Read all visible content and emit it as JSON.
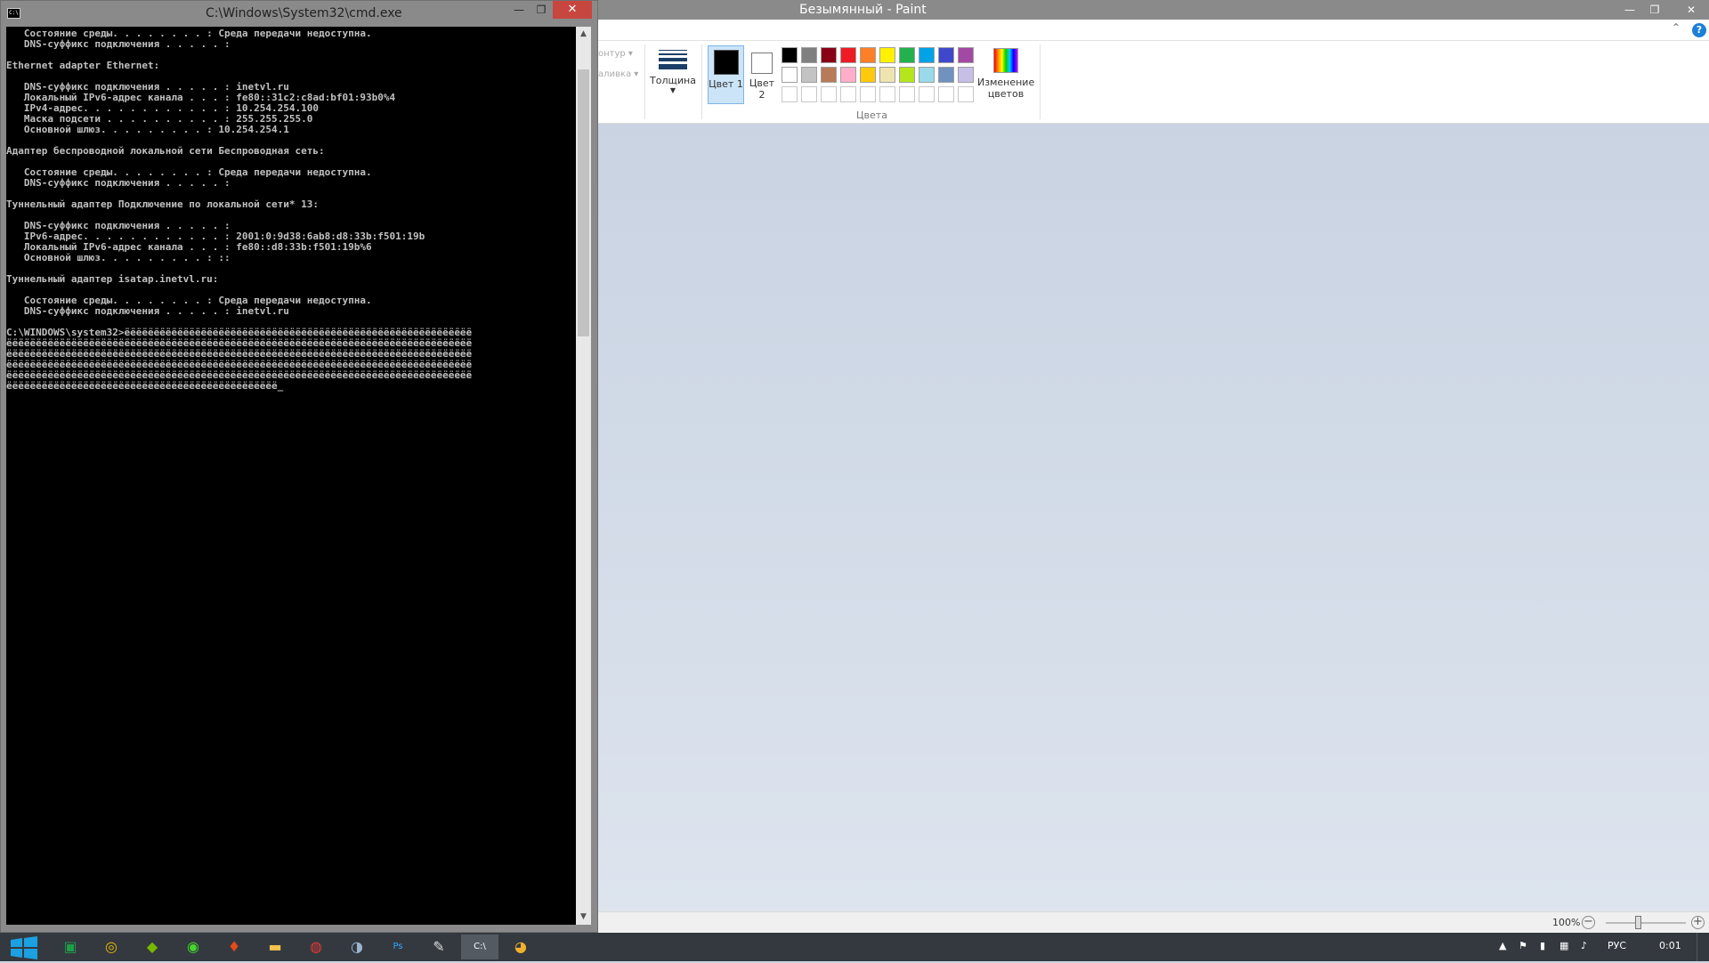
{
  "paint": {
    "title": "Безымянный - Paint",
    "ribbon": {
      "contour_label": "онтур ▾",
      "fill_label": "аливка ▾",
      "thickness_label": "Толщина",
      "color1_label": "Цвет 1",
      "color2_label": "Цвет 2",
      "edit_colors_label": "Изменение цветов",
      "colors_group_label": "Цвета"
    },
    "palette": [
      "#000000",
      "#7f7f7f",
      "#880015",
      "#ed1c24",
      "#ff7f27",
      "#fff200",
      "#22b14c",
      "#00a2e8",
      "#3f48cc",
      "#a349a4",
      "#ffffff",
      "#c3c3c3",
      "#b97a57",
      "#ffaec9",
      "#ffc90e",
      "#efe4b0",
      "#b5e61d",
      "#99d9ea",
      "#7092be",
      "#c8bfe7",
      "#ffffff",
      "#ffffff",
      "#ffffff",
      "#ffffff",
      "#ffffff",
      "#ffffff",
      "#ffffff",
      "#ffffff",
      "#ffffff",
      "#ffffff"
    ],
    "zoom": "100%",
    "zoom_fraction": 0.4
  },
  "cmd": {
    "title": "C:\\Windows\\System32\\cmd.exe",
    "lines": [
      "   Состояние среды. . . . . . . . : Среда передачи недоступна.",
      "   DNS-суффикс подключения . . . . . :",
      "",
      "Ethernet adapter Ethernet:",
      "",
      "   DNS-суффикс подключения . . . . . : inetvl.ru",
      "   Локальный IPv6-адрес канала . . . : fe80::31c2:c8ad:bf01:93b0%4",
      "   IPv4-адрес. . . . . . . . . . . . : 10.254.254.100",
      "   Маска подсети . . . . . . . . . . : 255.255.255.0",
      "   Основной шлюз. . . . . . . . . : 10.254.254.1",
      "",
      "Адаптер беспроводной локальной сети Беспроводная сеть:",
      "",
      "   Состояние среды. . . . . . . . : Среда передачи недоступна.",
      "   DNS-суффикс подключения . . . . . :",
      "",
      "Туннельный адаптер Подключение по локальной сети* 13:",
      "",
      "   DNS-суффикс подключения . . . . . :",
      "   IPv6-адрес. . . . . . . . . . . . : 2001:0:9d38:6ab8:d8:33b:f501:19b",
      "   Локальный IPv6-адрес канала . . . : fe80::d8:33b:f501:19b%6",
      "   Основной шлюз. . . . . . . . . : ::",
      "",
      "Туннельный адаптер isatap.inetvl.ru:",
      "",
      "   Состояние среды. . . . . . . . : Среда передачи недоступна.",
      "   DNS-суффикс подключения . . . . . : inetvl.ru",
      "",
      "C:\\WINDOWS\\system32>ёёёёёёёёёёёёёёёёёёёёёёёёёёёёёёёёёёёёёёёёёёёёёёёёёёёёёёёёёёё",
      "ёёёёёёёёёёёёёёёёёёёёёёёёёёёёёёёёёёёёёёёёёёёёёёёёёёёёёёёёёёёёёёёёёёёёёёёёёёёёёёё",
      "ёёёёёёёёёёёёёёёёёёёёёёёёёёёёёёёёёёёёёёёёёёёёёёёёёёёёёёёёёёёёёёёёёёёёёёёёёёёёёёё",
      "ёёёёёёёёёёёёёёёёёёёёёёёёёёёёёёёёёёёёёёёёёёёёёёёёёёёёёёёёёёёёёёёёёёёёёёёёёёёёёёё",
      "ёёёёёёёёёёёёёёёёёёёёёёёёёёёёёёёёёёёёёёёёёёёёёёёёёёёёёёёёёёёёёёёёёёёёёёёёёёёёёёё",
      "ёёёёёёёёёёёёёёёёёёёёёёёёёёёёёёёёёёёёёёёёёёёёёё_"
    ]
  },
  "taskbar": {
    "apps": [
      {
        "name": "taskbar-app-excel",
        "glyph": "▣",
        "color": "#1e9e4a",
        "active": false
      },
      {
        "name": "taskbar-app-chrome-canary",
        "glyph": "◎",
        "color": "#e6b800",
        "active": false
      },
      {
        "name": "taskbar-app-nvidia",
        "glyph": "◆",
        "color": "#76b900",
        "active": false
      },
      {
        "name": "taskbar-app-razer",
        "glyph": "◉",
        "color": "#44d62c",
        "active": false
      },
      {
        "name": "taskbar-app-software-center",
        "glyph": "♦",
        "color": "#e64a19",
        "active": false
      },
      {
        "name": "taskbar-app-explorer",
        "glyph": "▬",
        "color": "#f2c14e",
        "active": false
      },
      {
        "name": "taskbar-app-chrome",
        "glyph": "◍",
        "color": "#e53935",
        "active": false
      },
      {
        "name": "taskbar-app-steam",
        "glyph": "◑",
        "color": "#9bb4d0",
        "active": false
      },
      {
        "name": "taskbar-app-photoshop",
        "glyph": "Ps",
        "color": "#31a8ff",
        "active": false
      },
      {
        "name": "taskbar-app-tool",
        "glyph": "✎",
        "color": "#dddddd",
        "active": false
      },
      {
        "name": "taskbar-app-cmd",
        "glyph": "C:\\",
        "color": "#ffffff",
        "active": true
      },
      {
        "name": "taskbar-app-paint",
        "glyph": "◕",
        "color": "#f0b030",
        "active": false
      }
    ],
    "language": "РУС",
    "time": "0:01"
  }
}
